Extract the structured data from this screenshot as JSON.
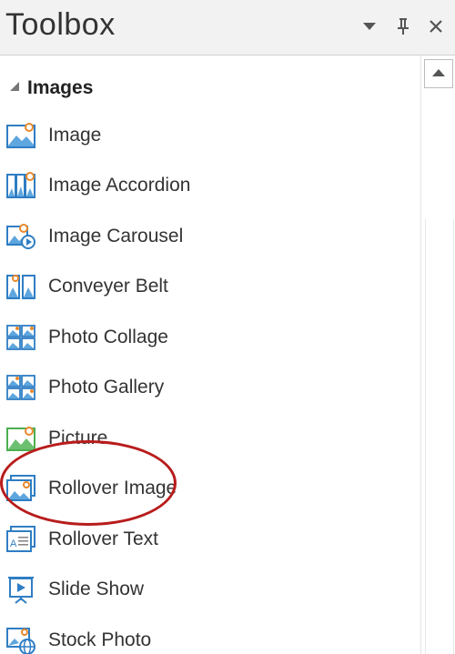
{
  "panel": {
    "title": "Toolbox"
  },
  "titlebar_buttons": [
    {
      "name": "dropdown-icon"
    },
    {
      "name": "pin-icon"
    },
    {
      "name": "close-icon"
    }
  ],
  "category": {
    "label": "Images",
    "expanded": true
  },
  "items": [
    {
      "label": "Image",
      "icon": "image-icon"
    },
    {
      "label": "Image Accordion",
      "icon": "image-accordion-icon"
    },
    {
      "label": "Image Carousel",
      "icon": "image-carousel-icon"
    },
    {
      "label": "Conveyer Belt",
      "icon": "conveyer-belt-icon"
    },
    {
      "label": "Photo Collage",
      "icon": "photo-collage-icon"
    },
    {
      "label": "Photo Gallery",
      "icon": "photo-gallery-icon"
    },
    {
      "label": "Picture",
      "icon": "picture-icon"
    },
    {
      "label": "Rollover Image",
      "icon": "rollover-image-icon"
    },
    {
      "label": "Rollover Text",
      "icon": "rollover-text-icon"
    },
    {
      "label": "Slide Show",
      "icon": "slide-show-icon"
    },
    {
      "label": "Stock Photo",
      "icon": "stock-photo-icon"
    }
  ],
  "highlighted_item": "Picture",
  "colors": {
    "icon_blue": "#2f7ec4",
    "icon_orange": "#e8892c",
    "icon_green": "#4caf50",
    "highlight_ring": "#b81c1c"
  }
}
